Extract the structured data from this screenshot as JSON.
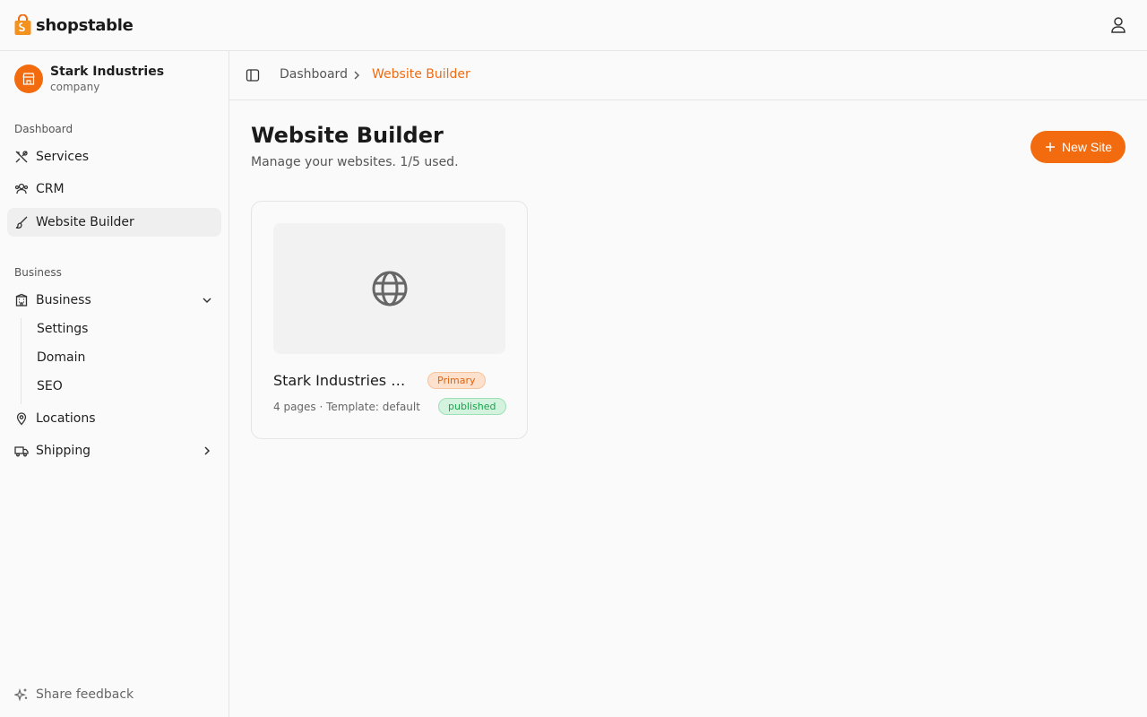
{
  "app": {
    "brand": "shopstable",
    "accent": "#f26b0f"
  },
  "header": {
    "user_icon": "user-icon"
  },
  "company": {
    "name": "Stark Industries",
    "type": "company",
    "icon": "store-icon"
  },
  "sidebar": {
    "sections": [
      {
        "label": "Dashboard",
        "items": [
          {
            "label": "Services",
            "icon": "tools-icon"
          },
          {
            "label": "CRM",
            "icon": "users-icon"
          },
          {
            "label": "Website Builder",
            "icon": "brush-icon",
            "active": true
          }
        ]
      },
      {
        "label": "Business",
        "items": [
          {
            "label": "Business",
            "icon": "building-icon",
            "expanded": true,
            "children": [
              "Settings",
              "Domain",
              "SEO"
            ]
          },
          {
            "label": "Locations",
            "icon": "map-pin-icon"
          },
          {
            "label": "Shipping",
            "icon": "truck-icon",
            "expanded": false
          }
        ]
      }
    ],
    "feedback": "Share feedback"
  },
  "breadcrumb": {
    "items": [
      "Dashboard",
      "Website Builder"
    ]
  },
  "page": {
    "title": "Website Builder",
    "subtitle": "Manage your websites. 1/5 used.",
    "new_button": "New Site"
  },
  "sites": [
    {
      "name": "Stark Industries We...",
      "badge": "Primary",
      "meta": "4 pages · Template: default",
      "status": "published",
      "icon": "globe-icon"
    }
  ]
}
